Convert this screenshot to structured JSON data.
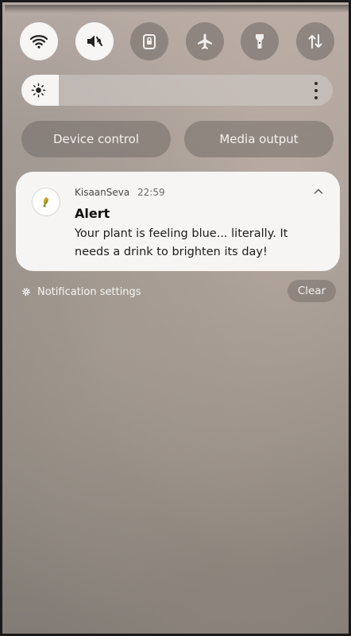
{
  "quick_settings": [
    {
      "name": "wifi",
      "icon": "wifi-icon",
      "active": true
    },
    {
      "name": "sound",
      "icon": "mute-icon",
      "active": true
    },
    {
      "name": "secure-folder",
      "icon": "lock-folder-icon",
      "active": false
    },
    {
      "name": "airplane",
      "icon": "airplane-icon",
      "active": false
    },
    {
      "name": "flashlight",
      "icon": "flashlight-icon",
      "active": false
    },
    {
      "name": "mobile-data",
      "icon": "data-arrows-icon",
      "active": false
    }
  ],
  "brightness": {
    "level": 0.12,
    "icon": "sun-icon",
    "menu_icon": "more-vertical-icon"
  },
  "buttons": {
    "device_control": "Device control",
    "media_output": "Media output"
  },
  "notification": {
    "app_name": "KisaanSeva",
    "time": "22:59",
    "title": "Alert",
    "body": "Your plant is feeling blue... literally. It needs a drink to brighten its day!",
    "icon": "kisaanseva-app-icon"
  },
  "footer": {
    "settings_label": "Notification settings",
    "clear_label": "Clear"
  }
}
